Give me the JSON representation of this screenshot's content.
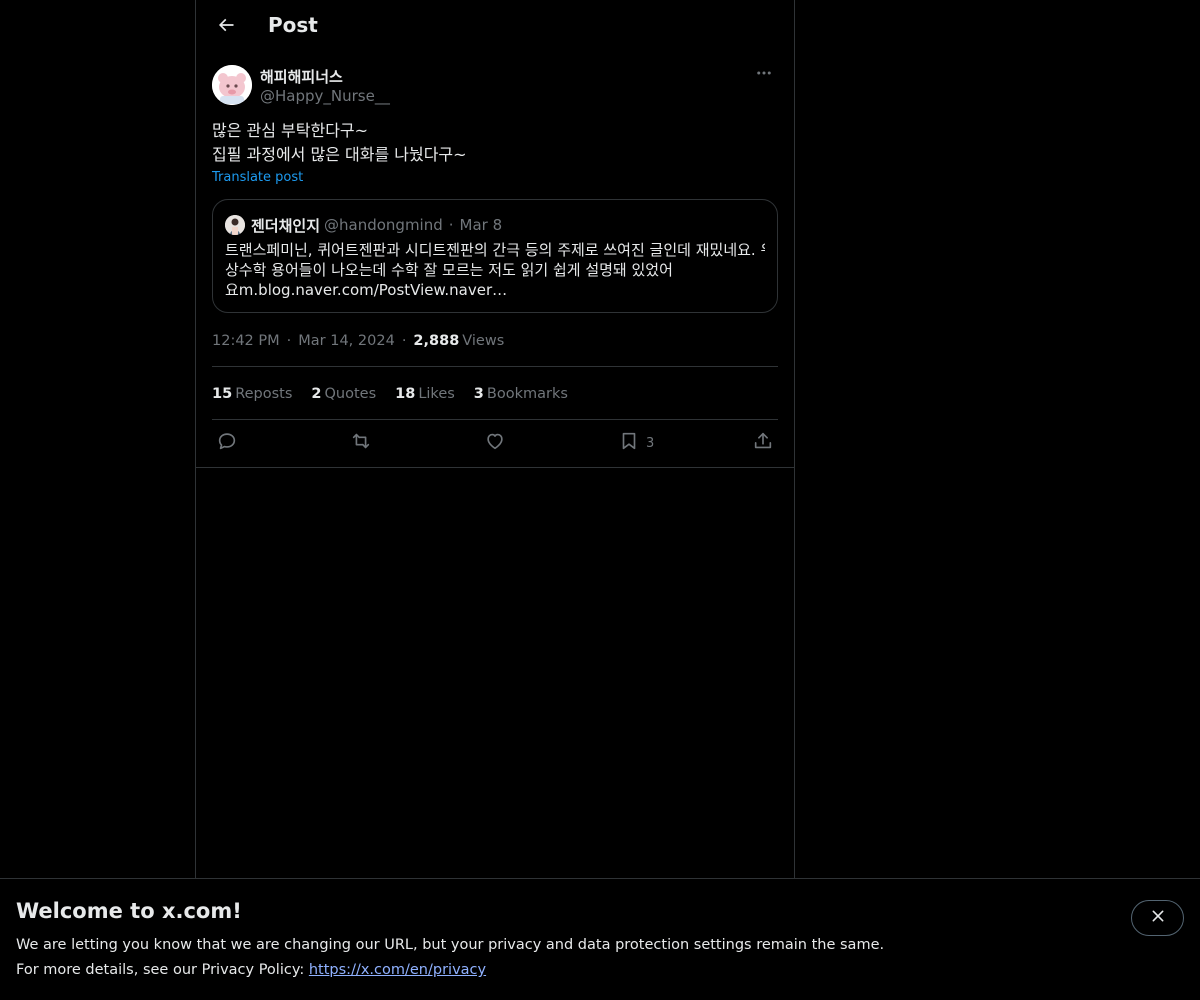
{
  "header": {
    "title": "Post",
    "back_icon": "arrow-left-icon"
  },
  "post": {
    "author": {
      "name": "해피해피너스",
      "handle": "@Happy_Nurse__"
    },
    "text_lines": [
      "많은 관심 부탁한다구~",
      "집필 과정에서 많은 대화를 나눴다구~"
    ],
    "translate_label": "Translate post",
    "quote": {
      "name": "젠더채인지",
      "handle": "@handongmind",
      "separator": "·",
      "date": "Mar 8",
      "body_lines": [
        "트랜스페미닌, 퀴어트젠판과 시디트젠판의 간극 등의 주제로 쓰여진 글인데 재밌네요. 위",
        "상수학 용어들이 나오는데 수학 잘 모르는 저도 읽기 쉽게 설명돼 있었어",
        "요m.blog.naver.com/PostView.naver…"
      ]
    },
    "meta": {
      "time": "12:42 PM",
      "separator": "·",
      "date": "Mar 14, 2024",
      "views_count": "2,888",
      "views_label": "Views"
    },
    "stats": {
      "reposts": {
        "count": "15",
        "label": "Reposts"
      },
      "quotes": {
        "count": "2",
        "label": "Quotes"
      },
      "likes": {
        "count": "18",
        "label": "Likes"
      },
      "bookmarks": {
        "count": "3",
        "label": "Bookmarks"
      }
    },
    "actions": {
      "reply_icon": "reply-icon",
      "repost_icon": "repost-icon",
      "like_icon": "heart-icon",
      "bookmark_icon": "bookmark-icon",
      "bookmark_count": "3",
      "share_icon": "share-icon"
    }
  },
  "banner": {
    "title": "Welcome to x.com!",
    "line1": "We are letting you know that we are changing our URL, but your privacy and data protection settings remain the same.",
    "line2_prefix": "For more details, see our Privacy Policy: ",
    "link_text": "https://x.com/en/privacy",
    "close_icon": "close-icon"
  },
  "colors": {
    "background": "#000000",
    "text_primary": "#e7e9ea",
    "text_secondary": "#71767b",
    "accent": "#1d9bf0",
    "border": "#2f3336",
    "link": "#8fb1ff"
  }
}
